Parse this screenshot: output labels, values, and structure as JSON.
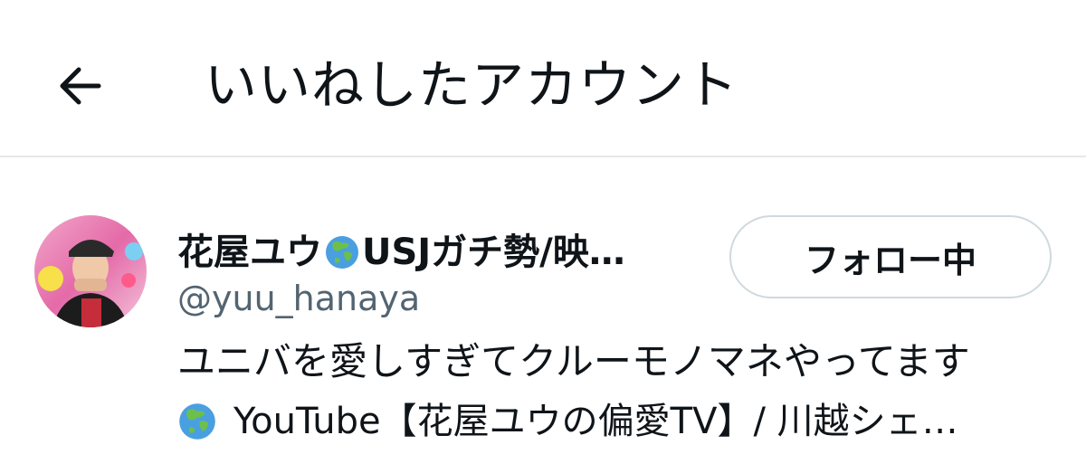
{
  "header": {
    "back_icon": "arrow-left-icon",
    "title": "いいねしたアカウント"
  },
  "user": {
    "display_name_prefix": "花屋ユウ",
    "display_name_suffix": "USJガチ勢/映…",
    "name_emoji": "globe-asia-icon",
    "handle": "@yuu_hanaya",
    "follow_label": "フォロー中",
    "bio_line1": "ユニバを愛しすぎてクルーモノマネやってます",
    "bio_line2": "YouTube【花屋ユウの偏愛TV】/ 川越シェ…"
  },
  "colors": {
    "text": "#0f1419",
    "secondary": "#536471",
    "border": "#cfd9de",
    "divider": "#e6e9eb"
  }
}
